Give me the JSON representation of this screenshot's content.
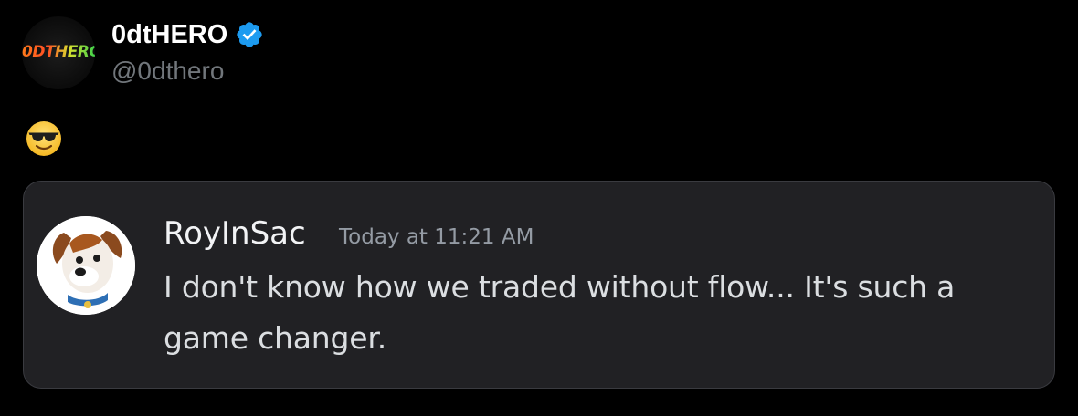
{
  "post": {
    "author": {
      "display_name": "0dtHERO",
      "handle": "@0dthero",
      "avatar_text": "0DTHERO",
      "verified_icon": "verified-badge-icon"
    },
    "body_emoji": "smiling-face-with-sunglasses"
  },
  "quoted_message": {
    "username": "RoyInSac",
    "timestamp": "Today at 11:21 AM",
    "text": "I don't know how we traded without flow... It's such a game changer.",
    "avatar_icon": "dog-avatar"
  },
  "colors": {
    "background": "#000000",
    "display_name": "#ffffff",
    "handle": "#71767b",
    "verified_blue": "#1d9bf0",
    "card_bg": "#212124",
    "card_border": "#3a3b40",
    "message_text": "#dbdee1",
    "timestamp": "#949ba4"
  }
}
